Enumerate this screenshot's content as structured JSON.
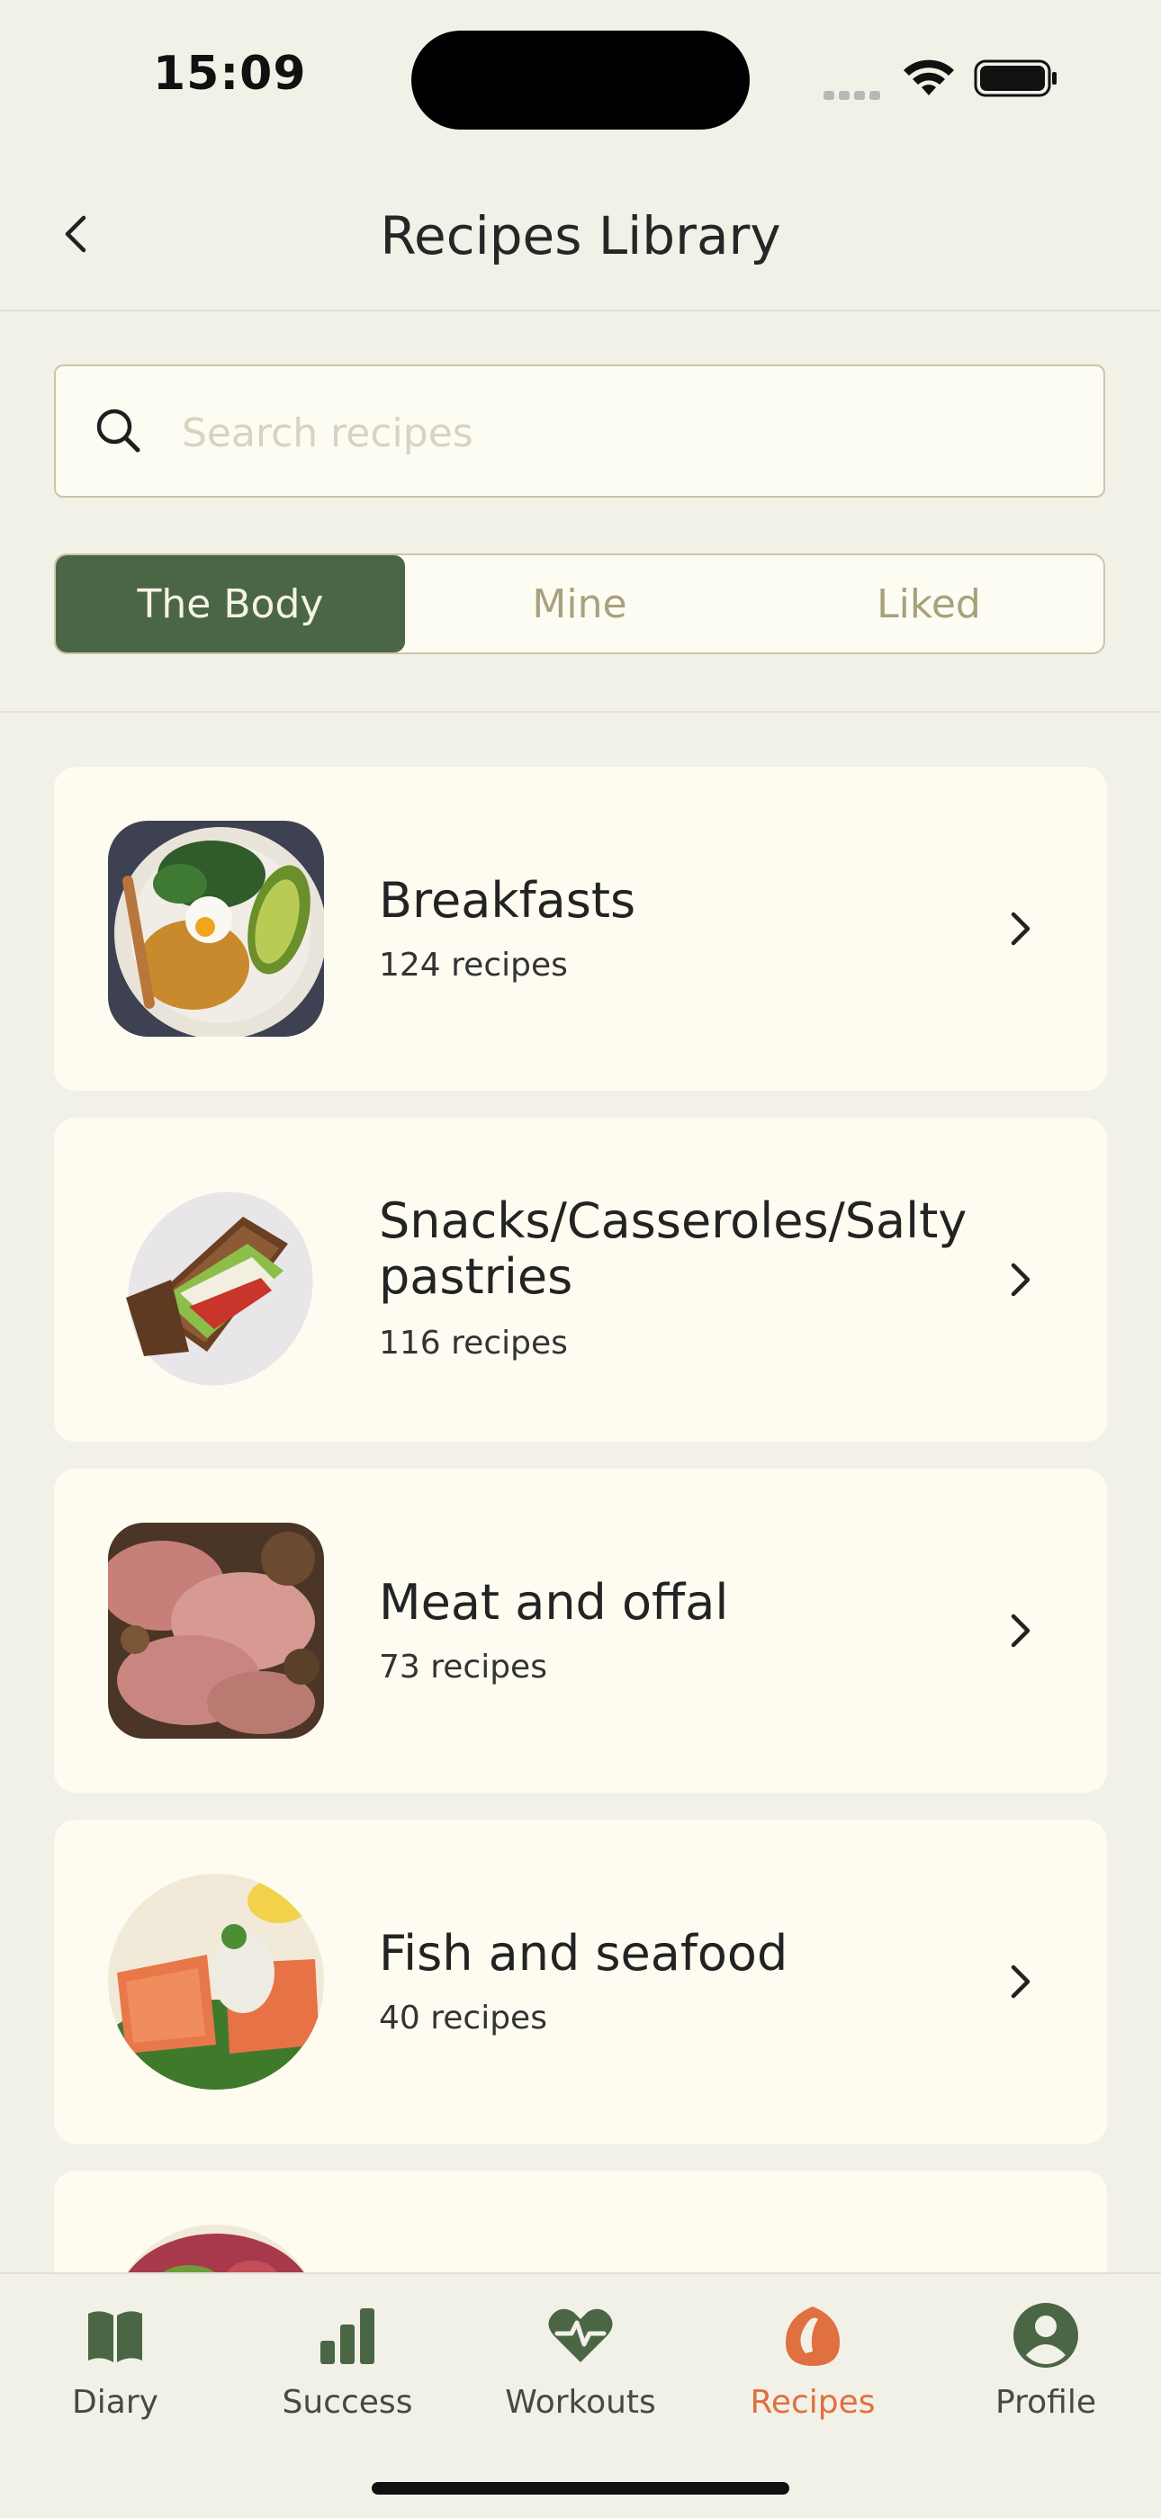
{
  "status_bar": {
    "time": "15:09"
  },
  "header": {
    "title": "Recipes Library",
    "back_icon": "chevron-left-icon"
  },
  "search": {
    "placeholder": "Search recipes",
    "value": ""
  },
  "segments": [
    {
      "label": "The Body",
      "active": true
    },
    {
      "label": "Mine",
      "active": false
    },
    {
      "label": "Liked",
      "active": false
    }
  ],
  "categories": [
    {
      "title": "Breakfasts",
      "count": "124 recipes",
      "image": "breakfast-bowl-image"
    },
    {
      "title": "Snacks/Casseroles/Salty pastries",
      "count": "116 recipes",
      "image": "sandwich-image"
    },
    {
      "title": "Meat and offal",
      "count": "73 recipes",
      "image": "roast-beef-image"
    },
    {
      "title": "Fish and seafood",
      "count": "40 recipes",
      "image": "salmon-image"
    },
    {
      "title": "",
      "count": "",
      "image": "salad-image"
    }
  ],
  "tabbar": {
    "items": [
      {
        "label": "Diary",
        "icon": "book-icon"
      },
      {
        "label": "Success",
        "icon": "bar-chart-icon"
      },
      {
        "label": "Workouts",
        "icon": "heart-pulse-icon"
      },
      {
        "label": "Recipes",
        "icon": "recipes-icon",
        "active": true
      },
      {
        "label": "Profile",
        "icon": "profile-icon"
      }
    ]
  },
  "colors": {
    "background": "#f2f1e8",
    "card": "#fefcf1",
    "accent_green": "#4b6645",
    "active_tab": "#e0703f",
    "tab_icon": "#4b6645"
  }
}
